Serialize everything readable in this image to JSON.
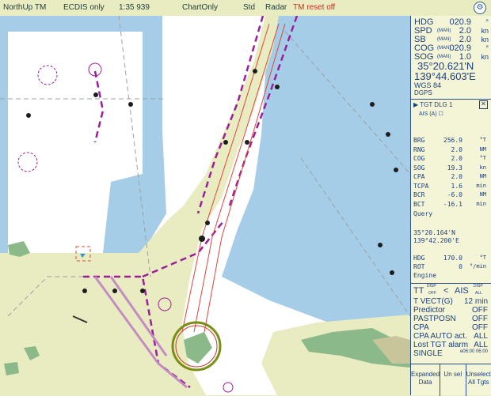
{
  "topbar": {
    "mode": "NorthUp TM",
    "ecdis": "ECDIS only",
    "scale": "1:35 939",
    "chart_only": "ChartOnly",
    "std": "Std",
    "radar": "Radar",
    "tm_reset": "TM reset off"
  },
  "nav": {
    "hdg": {
      "label": "HDG",
      "value": "020.9",
      "unit": "°"
    },
    "spd": {
      "label": "SPD",
      "mode": "(MAN)",
      "value": "2.0",
      "unit": "kn"
    },
    "sb": {
      "label": "SB",
      "mode": "(MAN)",
      "value": "2.0",
      "unit": "kn"
    },
    "cog": {
      "label": "COG",
      "mode": "(MAN)",
      "value": "020.9",
      "unit": "°"
    },
    "sog": {
      "label": "SOG",
      "mode": "(MAN)",
      "value": "1.0",
      "unit": "kn"
    },
    "lat": "35°20.621'N",
    "lon": "139°44.603'E",
    "datum": "WGS 84",
    "source": "DGPS"
  },
  "target": {
    "title": "TGT DLG 1",
    "type": "AIS (A)",
    "rows": [
      {
        "k": "BRG",
        "v": "256.9",
        "u": "°T"
      },
      {
        "k": "RNG",
        "v": "2.0",
        "u": "NM"
      },
      {
        "k": "COG",
        "v": "2.0",
        "u": "°T"
      },
      {
        "k": "SOG",
        "v": "19.3",
        "u": "kn"
      },
      {
        "k": "CPA",
        "v": "2.0",
        "u": "NM"
      },
      {
        "k": "TCPA",
        "v": "1.6",
        "u": "min"
      },
      {
        "k": "BCR",
        "v": "-6.0",
        "u": "NM"
      },
      {
        "k": "BCT",
        "v": "-16.1",
        "u": "min"
      }
    ],
    "query": "Query",
    "lat": "35°20.164'N",
    "lon": "139°42.200'E",
    "hdg": {
      "k": "HDG",
      "v": "170.0",
      "u": "°T"
    },
    "rot": {
      "k": "ROT",
      "v": "0",
      "u": "°/min"
    },
    "engine": "Engine"
  },
  "settings": {
    "tt": "TT",
    "tt_sup": "DISP",
    "tt_sub": "OFF",
    "lt": "<",
    "ais": "AIS",
    "ais_sup": "DISP",
    "ais_sub": "ALL",
    "rows": [
      {
        "k": "T VECT(G)",
        "v": "12 min"
      },
      {
        "k": "Predictor",
        "v": "OFF"
      },
      {
        "k": "PASTPOSN",
        "v": "OFF"
      },
      {
        "k": "CPA",
        "v": "OFF"
      },
      {
        "k": "CPA AUTO act.",
        "v": "ALL"
      },
      {
        "k": "Lost TGT alarm",
        "v": "ALL"
      },
      {
        "k": "SINGLE",
        "v": "e06:00 06:00"
      }
    ]
  },
  "buttons": {
    "expanded": "Expanded Data",
    "unsel": "Un sel",
    "unselect_all": "Unselect All Tgts"
  },
  "colors": {
    "land": "#e9ecc1",
    "shallow": "#a6cde8",
    "deep": "#ffffff",
    "route": "#9b1f99",
    "fairway": "#e0443a",
    "panel_text": "#1c3f7c",
    "warning": "#d2281e"
  }
}
